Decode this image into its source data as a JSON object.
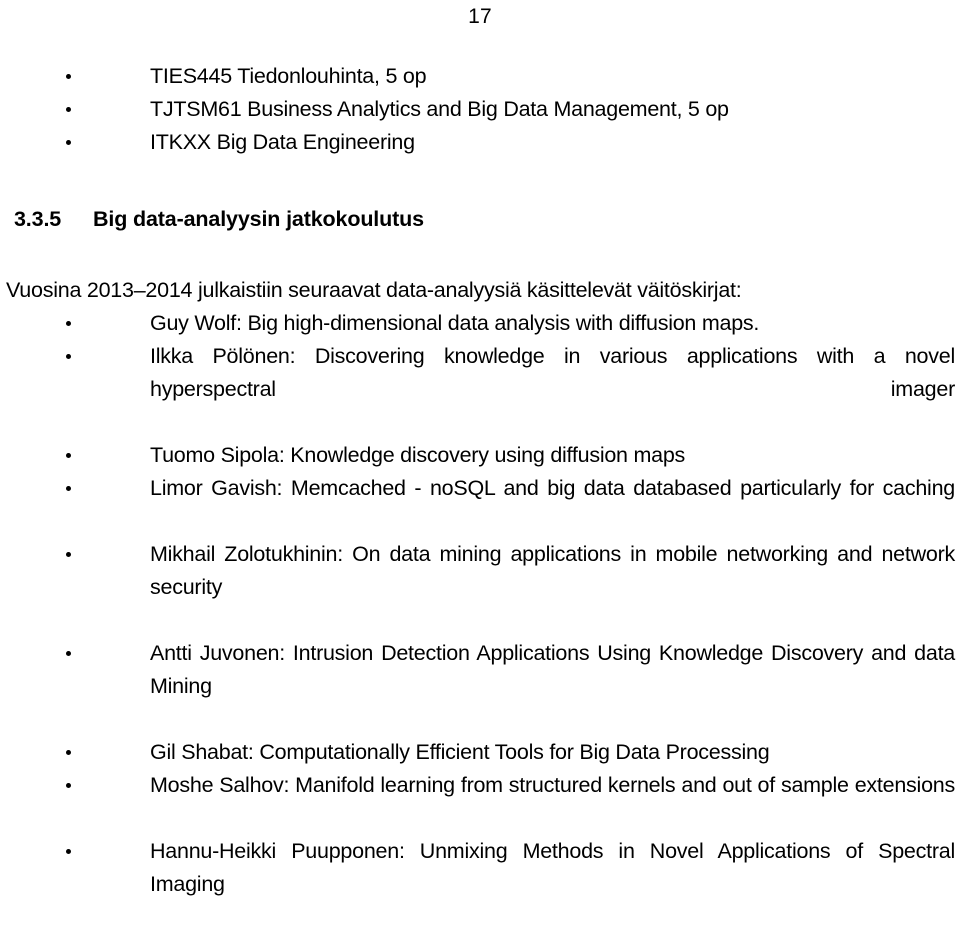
{
  "document": {
    "page_number": "17",
    "top_list": [
      "TIES445 Tiedonlouhinta, 5 op",
      "TJTSM61 Business Analytics and Big Data Management, 5 op",
      "ITKXX Big Data Engineering"
    ],
    "heading": {
      "number": "3.3.5",
      "title": "Big data-analyysin jatkokoulutus"
    },
    "intro_paragraph": "Vuosina 2013–2014 julkaistiin seuraavat data-analyysiä käsittelevät väitöskirjat:",
    "dissertation_list": [
      "Guy Wolf: Big high-dimensional data analysis with diffusion maps.",
      "Ilkka Pölönen: Discovering knowledge in various applications with a novel hyperspectral imager",
      "Tuomo Sipola: Knowledge discovery using diffusion maps",
      "Limor Gavish: Memcached - noSQL and big data databased particularly for caching",
      "Mikhail Zolotukhinin: On data mining applications in mobile networking and network security",
      "Antti Juvonen: Intrusion Detection Applications Using Knowledge Discovery and data Mining",
      "Gil Shabat: Computationally Efficient Tools for Big Data Processing",
      "Moshe Salhov: Manifold learning from structured kernels and out of sample extensions",
      "Hannu-Heikki Puupponen: Unmixing Methods in Novel Applications of Spectral Imaging"
    ],
    "bullet_glyph": "•",
    "colors": {
      "text": "#000000",
      "background": "#ffffff"
    }
  }
}
